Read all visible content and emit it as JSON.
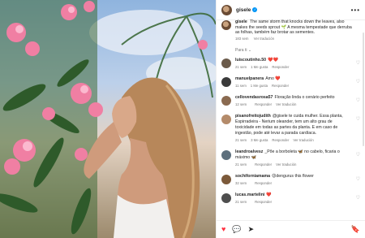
{
  "post": {
    "username": "gisele",
    "verified_glyph": "✓",
    "more_glyph": "•••"
  },
  "caption": {
    "username": "gisele",
    "text": "The same storm that knocks down the leaves, also makes the seeds sprout 🌱 A mesma tempestade que derruba as folhas, também faz brotar as sementes.",
    "time": "183 sem",
    "translate": "Ver tradución"
  },
  "see_more": "Para ti ⌄",
  "comments": [
    {
      "username": "luiscoutinho.50",
      "text": "❤️❤️",
      "time": "21 sem",
      "likes": "1 Me gusta",
      "reply": "Responder",
      "translate": "",
      "color": "#6b5b4b"
    },
    {
      "username": "manuelpanera",
      "text": "Amo ❤️",
      "time": "11 sem",
      "likes": "1 Me gusta",
      "reply": "Responder",
      "translate": "",
      "color": "#3a3a3a"
    },
    {
      "username": "cellovendasrosa57",
      "text": "Floração linda o cenário perfeito",
      "time": "12 sem",
      "likes": "",
      "reply": "Responder",
      "translate": "Ver tradución",
      "color": "#8a6a50"
    },
    {
      "username": "pisanofreitojudith",
      "text": "@gisele te cuida mulher. Essa planta, Espirradeira - Nerium oleander, tem um alto grau de toxicidade em todas as partes da planta. E em caso de ingestão, pode até levar a parada cardíaca.",
      "time": "21 sem",
      "likes": "3 Me gusta",
      "reply": "Responder",
      "translate": "Ver tradución",
      "color": "#b48b6a"
    },
    {
      "username": "leandroalvesz",
      "text": "_Põe a borboleta 🦋 no cabelo, ficaria o máximo 🦋",
      "time": "21 sem",
      "likes": "",
      "reply": "Responder",
      "translate": "Ver tradución",
      "color": "#5d6f7c"
    },
    {
      "username": "sochiforniamama",
      "text": "😍dengurus this flower",
      "time": "32 sem",
      "likes": "",
      "reply": "Responder",
      "translate": "",
      "color": "#7c5a3a"
    },
    {
      "username": "lucas.martelini",
      "text": "❤️",
      "time": "21 sem",
      "likes": "",
      "reply": "Responder",
      "translate": "",
      "color": "#4e4e4e"
    }
  ],
  "actions": {
    "like": "♥",
    "comment": "💬",
    "share": "➤",
    "save": "🔖"
  }
}
